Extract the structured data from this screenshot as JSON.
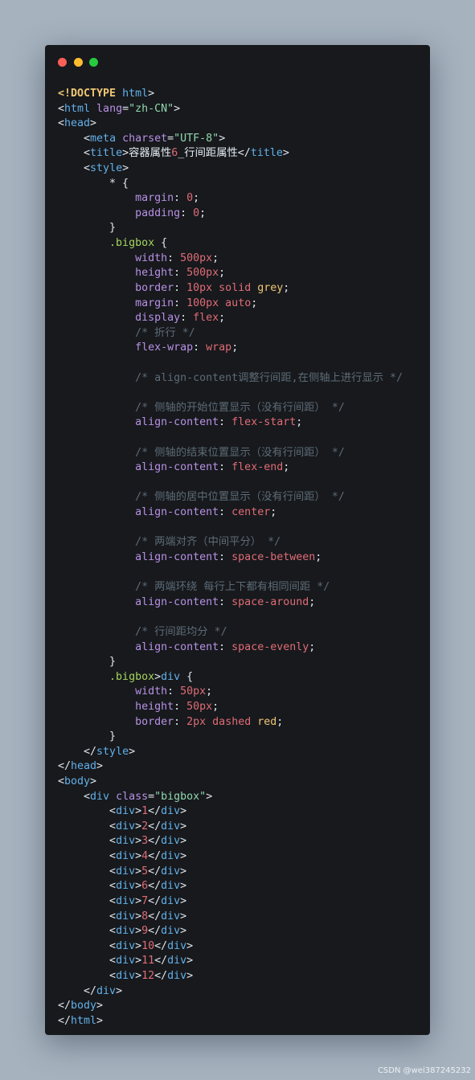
{
  "window": {
    "buttons": {
      "close": "#ff5f56",
      "minimize": "#ffbd2e",
      "maximize": "#27c93f"
    }
  },
  "code_lines": [
    [
      [
        "doctype",
        "<!DOCTYPE"
      ],
      [
        "doctype-rest",
        " html"
      ],
      [
        "punct",
        ">"
      ]
    ],
    [
      [
        "punct",
        "<"
      ],
      [
        "tag",
        "html"
      ],
      [
        "attr",
        " lang"
      ],
      [
        "punct",
        "="
      ],
      [
        "str",
        "\"zh-CN\""
      ],
      [
        "punct",
        ">"
      ]
    ],
    [
      [
        "punct",
        "<"
      ],
      [
        "tag",
        "head"
      ],
      [
        "punct",
        ">"
      ]
    ],
    [
      [
        "text",
        "    "
      ],
      [
        "punct",
        "<"
      ],
      [
        "tag",
        "meta"
      ],
      [
        "attr",
        " charset"
      ],
      [
        "punct",
        "="
      ],
      [
        "str",
        "\"UTF-8\""
      ],
      [
        "punct",
        ">"
      ]
    ],
    [
      [
        "text",
        "    "
      ],
      [
        "punct",
        "<"
      ],
      [
        "tag",
        "title"
      ],
      [
        "punct",
        ">"
      ],
      [
        "text",
        "容器属性"
      ],
      [
        "num",
        "6"
      ],
      [
        "text",
        "_行间距属性"
      ],
      [
        "punct",
        "</"
      ],
      [
        "tag",
        "title"
      ],
      [
        "punct",
        ">"
      ]
    ],
    [
      [
        "text",
        "    "
      ],
      [
        "punct",
        "<"
      ],
      [
        "tag",
        "style"
      ],
      [
        "punct",
        ">"
      ]
    ],
    [
      [
        "text",
        "        "
      ],
      [
        "punct",
        "* {"
      ]
    ],
    [
      [
        "text",
        "            "
      ],
      [
        "prop",
        "margin"
      ],
      [
        "punct",
        ": "
      ],
      [
        "num",
        "0"
      ],
      [
        "punct",
        ";"
      ]
    ],
    [
      [
        "text",
        "            "
      ],
      [
        "prop",
        "padding"
      ],
      [
        "punct",
        ": "
      ],
      [
        "num",
        "0"
      ],
      [
        "punct",
        ";"
      ]
    ],
    [
      [
        "text",
        "        "
      ],
      [
        "punct",
        "}"
      ]
    ],
    [
      [
        "text",
        "        "
      ],
      [
        "selector",
        ".bigbox"
      ],
      [
        "punct",
        " {"
      ]
    ],
    [
      [
        "text",
        "            "
      ],
      [
        "prop",
        "width"
      ],
      [
        "punct",
        ": "
      ],
      [
        "num",
        "500px"
      ],
      [
        "punct",
        ";"
      ]
    ],
    [
      [
        "text",
        "            "
      ],
      [
        "prop",
        "height"
      ],
      [
        "punct",
        ": "
      ],
      [
        "num",
        "500px"
      ],
      [
        "punct",
        ";"
      ]
    ],
    [
      [
        "text",
        "            "
      ],
      [
        "prop",
        "border"
      ],
      [
        "punct",
        ": "
      ],
      [
        "num",
        "10px"
      ],
      [
        "kw",
        " solid"
      ],
      [
        "color",
        " grey"
      ],
      [
        "punct",
        ";"
      ]
    ],
    [
      [
        "text",
        "            "
      ],
      [
        "prop",
        "margin"
      ],
      [
        "punct",
        ": "
      ],
      [
        "num",
        "100px"
      ],
      [
        "kw",
        " auto"
      ],
      [
        "punct",
        ";"
      ]
    ],
    [
      [
        "text",
        "            "
      ],
      [
        "prop",
        "display"
      ],
      [
        "punct",
        ": "
      ],
      [
        "kw",
        "flex"
      ],
      [
        "punct",
        ";"
      ]
    ],
    [
      [
        "text",
        "            "
      ],
      [
        "comment",
        "/* 折行 */"
      ]
    ],
    [
      [
        "text",
        "            "
      ],
      [
        "prop",
        "flex-wrap"
      ],
      [
        "punct",
        ": "
      ],
      [
        "kw",
        "wrap"
      ],
      [
        "punct",
        ";"
      ]
    ],
    [],
    [
      [
        "text",
        "            "
      ],
      [
        "comment",
        "/* align-content调整行间距,在侧轴上进行显示 */"
      ]
    ],
    [],
    [
      [
        "text",
        "            "
      ],
      [
        "comment",
        "/* 侧轴的开始位置显示（没有行间距） */"
      ]
    ],
    [
      [
        "text",
        "            "
      ],
      [
        "prop",
        "align-content"
      ],
      [
        "punct",
        ": "
      ],
      [
        "kw",
        "flex-start"
      ],
      [
        "punct",
        ";"
      ]
    ],
    [],
    [
      [
        "text",
        "            "
      ],
      [
        "comment",
        "/* 侧轴的结束位置显示（没有行间距） */"
      ]
    ],
    [
      [
        "text",
        "            "
      ],
      [
        "prop",
        "align-content"
      ],
      [
        "punct",
        ": "
      ],
      [
        "kw",
        "flex-end"
      ],
      [
        "punct",
        ";"
      ]
    ],
    [],
    [
      [
        "text",
        "            "
      ],
      [
        "comment",
        "/* 侧轴的居中位置显示（没有行间距） */"
      ]
    ],
    [
      [
        "text",
        "            "
      ],
      [
        "prop",
        "align-content"
      ],
      [
        "punct",
        ": "
      ],
      [
        "kw",
        "center"
      ],
      [
        "punct",
        ";"
      ]
    ],
    [],
    [
      [
        "text",
        "            "
      ],
      [
        "comment",
        "/* 两端对齐（中间平分） */"
      ]
    ],
    [
      [
        "text",
        "            "
      ],
      [
        "prop",
        "align-content"
      ],
      [
        "punct",
        ": "
      ],
      [
        "kw",
        "space-between"
      ],
      [
        "punct",
        ";"
      ]
    ],
    [],
    [
      [
        "text",
        "            "
      ],
      [
        "comment",
        "/* 两端环绕 每行上下都有相同间距 */"
      ]
    ],
    [
      [
        "text",
        "            "
      ],
      [
        "prop",
        "align-content"
      ],
      [
        "punct",
        ": "
      ],
      [
        "kw",
        "space-around"
      ],
      [
        "punct",
        ";"
      ]
    ],
    [],
    [
      [
        "text",
        "            "
      ],
      [
        "comment",
        "/* 行间距均分 */"
      ]
    ],
    [
      [
        "text",
        "            "
      ],
      [
        "prop",
        "align-content"
      ],
      [
        "punct",
        ": "
      ],
      [
        "kw",
        "space-evenly"
      ],
      [
        "punct",
        ";"
      ]
    ],
    [
      [
        "text",
        "        "
      ],
      [
        "punct",
        "}"
      ]
    ],
    [
      [
        "text",
        "        "
      ],
      [
        "selector",
        ".bigbox"
      ],
      [
        "punct",
        ">"
      ],
      [
        "tag",
        "div"
      ],
      [
        "punct",
        " {"
      ]
    ],
    [
      [
        "text",
        "            "
      ],
      [
        "prop",
        "width"
      ],
      [
        "punct",
        ": "
      ],
      [
        "num",
        "50px"
      ],
      [
        "punct",
        ";"
      ]
    ],
    [
      [
        "text",
        "            "
      ],
      [
        "prop",
        "height"
      ],
      [
        "punct",
        ": "
      ],
      [
        "num",
        "50px"
      ],
      [
        "punct",
        ";"
      ]
    ],
    [
      [
        "text",
        "            "
      ],
      [
        "prop",
        "border"
      ],
      [
        "punct",
        ": "
      ],
      [
        "num",
        "2px"
      ],
      [
        "kw",
        " dashed"
      ],
      [
        "color",
        " red"
      ],
      [
        "punct",
        ";"
      ]
    ],
    [
      [
        "text",
        "        "
      ],
      [
        "punct",
        "}"
      ]
    ],
    [
      [
        "text",
        "    "
      ],
      [
        "punct",
        "</"
      ],
      [
        "tag",
        "style"
      ],
      [
        "punct",
        ">"
      ]
    ],
    [
      [
        "punct",
        "</"
      ],
      [
        "tag",
        "head"
      ],
      [
        "punct",
        ">"
      ]
    ],
    [
      [
        "punct",
        "<"
      ],
      [
        "tag",
        "body"
      ],
      [
        "punct",
        ">"
      ]
    ],
    [
      [
        "text",
        "    "
      ],
      [
        "punct",
        "<"
      ],
      [
        "tag",
        "div"
      ],
      [
        "attr",
        " class"
      ],
      [
        "punct",
        "="
      ],
      [
        "str",
        "\"bigbox\""
      ],
      [
        "punct",
        ">"
      ]
    ],
    [
      [
        "text",
        "        "
      ],
      [
        "punct",
        "<"
      ],
      [
        "tag",
        "div"
      ],
      [
        "punct",
        ">"
      ],
      [
        "num",
        "1"
      ],
      [
        "punct",
        "</"
      ],
      [
        "tag",
        "div"
      ],
      [
        "punct",
        ">"
      ]
    ],
    [
      [
        "text",
        "        "
      ],
      [
        "punct",
        "<"
      ],
      [
        "tag",
        "div"
      ],
      [
        "punct",
        ">"
      ],
      [
        "num",
        "2"
      ],
      [
        "punct",
        "</"
      ],
      [
        "tag",
        "div"
      ],
      [
        "punct",
        ">"
      ]
    ],
    [
      [
        "text",
        "        "
      ],
      [
        "punct",
        "<"
      ],
      [
        "tag",
        "div"
      ],
      [
        "punct",
        ">"
      ],
      [
        "num",
        "3"
      ],
      [
        "punct",
        "</"
      ],
      [
        "tag",
        "div"
      ],
      [
        "punct",
        ">"
      ]
    ],
    [
      [
        "text",
        "        "
      ],
      [
        "punct",
        "<"
      ],
      [
        "tag",
        "div"
      ],
      [
        "punct",
        ">"
      ],
      [
        "num",
        "4"
      ],
      [
        "punct",
        "</"
      ],
      [
        "tag",
        "div"
      ],
      [
        "punct",
        ">"
      ]
    ],
    [
      [
        "text",
        "        "
      ],
      [
        "punct",
        "<"
      ],
      [
        "tag",
        "div"
      ],
      [
        "punct",
        ">"
      ],
      [
        "num",
        "5"
      ],
      [
        "punct",
        "</"
      ],
      [
        "tag",
        "div"
      ],
      [
        "punct",
        ">"
      ]
    ],
    [
      [
        "text",
        "        "
      ],
      [
        "punct",
        "<"
      ],
      [
        "tag",
        "div"
      ],
      [
        "punct",
        ">"
      ],
      [
        "num",
        "6"
      ],
      [
        "punct",
        "</"
      ],
      [
        "tag",
        "div"
      ],
      [
        "punct",
        ">"
      ]
    ],
    [
      [
        "text",
        "        "
      ],
      [
        "punct",
        "<"
      ],
      [
        "tag",
        "div"
      ],
      [
        "punct",
        ">"
      ],
      [
        "num",
        "7"
      ],
      [
        "punct",
        "</"
      ],
      [
        "tag",
        "div"
      ],
      [
        "punct",
        ">"
      ]
    ],
    [
      [
        "text",
        "        "
      ],
      [
        "punct",
        "<"
      ],
      [
        "tag",
        "div"
      ],
      [
        "punct",
        ">"
      ],
      [
        "num",
        "8"
      ],
      [
        "punct",
        "</"
      ],
      [
        "tag",
        "div"
      ],
      [
        "punct",
        ">"
      ]
    ],
    [
      [
        "text",
        "        "
      ],
      [
        "punct",
        "<"
      ],
      [
        "tag",
        "div"
      ],
      [
        "punct",
        ">"
      ],
      [
        "num",
        "9"
      ],
      [
        "punct",
        "</"
      ],
      [
        "tag",
        "div"
      ],
      [
        "punct",
        ">"
      ]
    ],
    [
      [
        "text",
        "        "
      ],
      [
        "punct",
        "<"
      ],
      [
        "tag",
        "div"
      ],
      [
        "punct",
        ">"
      ],
      [
        "num",
        "10"
      ],
      [
        "punct",
        "</"
      ],
      [
        "tag",
        "div"
      ],
      [
        "punct",
        ">"
      ]
    ],
    [
      [
        "text",
        "        "
      ],
      [
        "punct",
        "<"
      ],
      [
        "tag",
        "div"
      ],
      [
        "punct",
        ">"
      ],
      [
        "num",
        "11"
      ],
      [
        "punct",
        "</"
      ],
      [
        "tag",
        "div"
      ],
      [
        "punct",
        ">"
      ]
    ],
    [
      [
        "text",
        "        "
      ],
      [
        "punct",
        "<"
      ],
      [
        "tag",
        "div"
      ],
      [
        "punct",
        ">"
      ],
      [
        "num",
        "12"
      ],
      [
        "punct",
        "</"
      ],
      [
        "tag",
        "div"
      ],
      [
        "punct",
        ">"
      ]
    ],
    [
      [
        "text",
        "    "
      ],
      [
        "punct",
        "</"
      ],
      [
        "tag",
        "div"
      ],
      [
        "punct",
        ">"
      ]
    ],
    [
      [
        "punct",
        "</"
      ],
      [
        "tag",
        "body"
      ],
      [
        "punct",
        ">"
      ]
    ],
    [
      [
        "punct",
        "</"
      ],
      [
        "tag",
        "html"
      ],
      [
        "punct",
        ">"
      ]
    ]
  ],
  "watermark": "CSDN @wei387245232"
}
